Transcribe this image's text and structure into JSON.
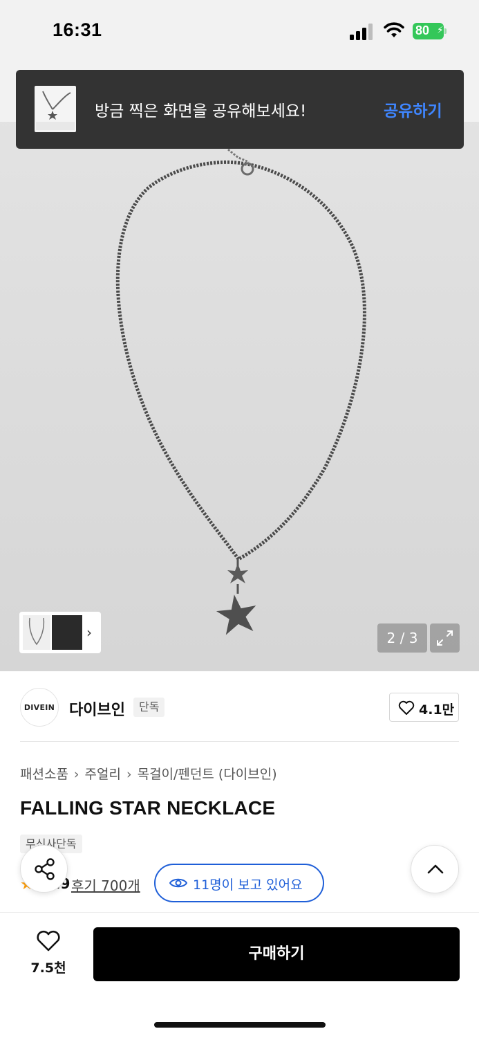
{
  "status_bar": {
    "time": "16:31",
    "battery": "80"
  },
  "toast": {
    "message": "방금 찍은 화면을 공유해보세요!",
    "action_label": "공유하기"
  },
  "gallery": {
    "counter": "2 / 3"
  },
  "brand": {
    "logo_text": "DIVEIN",
    "name": "다이브인",
    "badge": "단독",
    "like_count": "4.1만"
  },
  "breadcrumb": [
    "패션소품",
    "주얼리",
    "목걸이/펜던트 (다이브인)"
  ],
  "product": {
    "title": "FALLING STAR NECKLACE",
    "exclusive_badge": "무신사단독",
    "rating": "4.9",
    "review_link": "후기 700개",
    "viewers": "11명이 보고 있어요"
  },
  "bottom": {
    "wish_count": "7.5천",
    "buy_label": "구매하기"
  },
  "colors": {
    "accent_blue": "#1f5fd8",
    "toast_action": "#3f86ff",
    "battery_green": "#34c759",
    "buy_button": "#000000"
  }
}
